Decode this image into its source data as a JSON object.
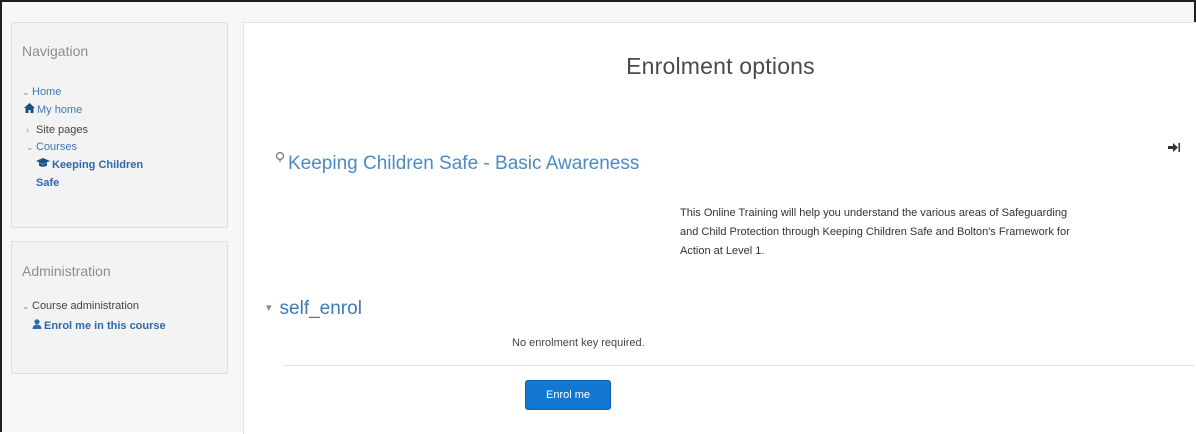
{
  "sidebar": {
    "navigation": {
      "title": "Navigation",
      "home": "Home",
      "my_home": "My home",
      "site_pages": "Site pages",
      "courses": "Courses",
      "course_line1": "Keeping Children",
      "course_line2": "Safe"
    },
    "administration": {
      "title": "Administration",
      "course_admin": "Course administration",
      "enrol_link": "Enrol me in this course"
    }
  },
  "main": {
    "page_title": "Enrolment options",
    "course_title": "Keeping Children Safe - Basic Awareness",
    "summary_line1": "This Online Training will help you understand the various areas of Safeguarding",
    "summary_line2": "and  Child Protection through Keeping Children Safe and Bolton's Framework for",
    "summary_line3": "Action at Level 1.",
    "section_title": "self_enrol",
    "no_key_text": "No enrolment key required.",
    "enrol_button": "Enrol me"
  },
  "icons": {
    "home": "house-icon",
    "courses_tree": "graduation-cap-icon",
    "enrol": "user-icon",
    "guest": "sign-in-icon",
    "course": "course-icon"
  },
  "colors": {
    "link": "#3d78b8",
    "button": "#1177d1",
    "title": "#4a4a4a"
  }
}
